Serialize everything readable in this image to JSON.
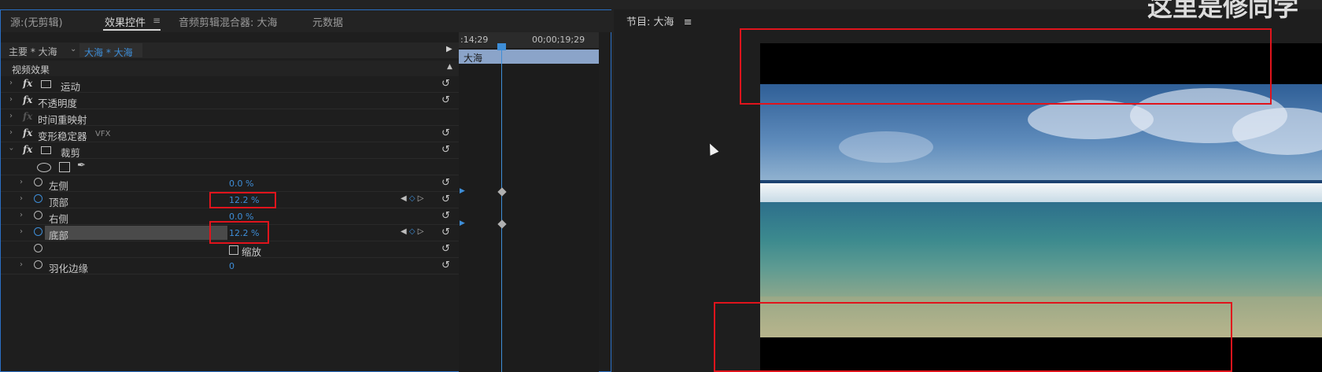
{
  "left_tabs": [
    {
      "label": "源:(无剪辑)"
    },
    {
      "label": "效果控件"
    },
    {
      "label": "音频剪辑混合器: 大海"
    },
    {
      "label": "元数据"
    }
  ],
  "tab_menu_glyph": "≡",
  "sequence": {
    "master": "主要 * 大海",
    "clip": "大海 * 大海"
  },
  "section_header": "视频效果",
  "effects": {
    "motion": "运动",
    "opacity": "不透明度",
    "time_remap": "时间重映射",
    "warp_stabilizer": "变形稳定器",
    "warp_stabilizer_tag": "VFX",
    "crop": "裁剪"
  },
  "crop_params": {
    "left": {
      "label": "左侧",
      "value": "0.0 %"
    },
    "top": {
      "label": "顶部",
      "value": "12.2 %"
    },
    "right": {
      "label": "右侧",
      "value": "0.0 %"
    },
    "bottom": {
      "label": "底部",
      "value": "12.2 %"
    },
    "zoom": {
      "label": "缩放"
    },
    "feather": {
      "label": "羽化边缘",
      "value": "0"
    }
  },
  "mini_timeline": {
    "ruler_left": ":14;29",
    "ruler_right": "00;00;19;29",
    "clip_name": "大海"
  },
  "program_monitor": {
    "title": "节目: 大海",
    "menu_glyph": "≡"
  },
  "watermark": "这里是修同学",
  "colors": {
    "accent": "#3e8ed8",
    "highlight": "#e0141c"
  }
}
